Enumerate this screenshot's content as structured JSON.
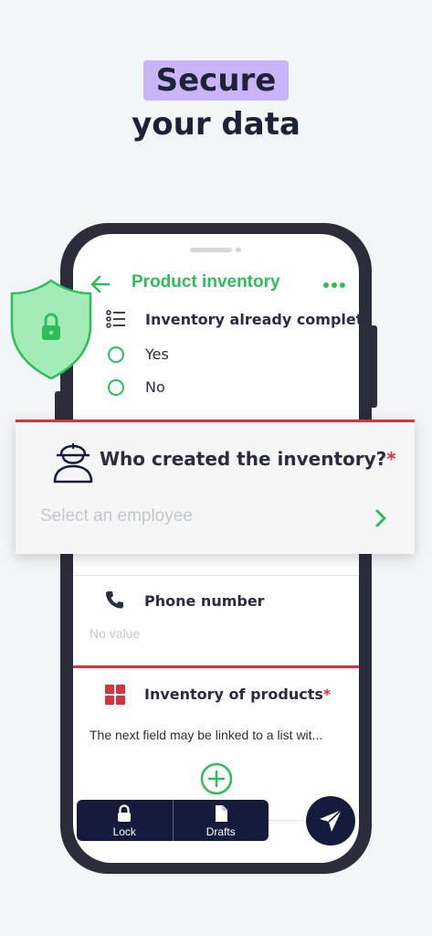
{
  "headline": {
    "line1": "Secure",
    "line2": "your data"
  },
  "app": {
    "title": "Product inventory",
    "back_icon": "arrow-left-icon",
    "more_icon": "more-dots-icon"
  },
  "question_complete": {
    "icon": "checklist-icon",
    "text": "Inventory already complete",
    "options": [
      {
        "label": "Yes"
      },
      {
        "label": "No"
      }
    ]
  },
  "employee_card": {
    "icon": "worker-helmet-icon",
    "question": "Who created the inventory?",
    "required_mark": "*",
    "placeholder": "Select an employee",
    "chevron_icon": "chevron-right-icon"
  },
  "phone_field": {
    "icon": "phone-icon",
    "label": "Phone number",
    "value": "No value"
  },
  "products_field": {
    "icon": "grid-icon",
    "label": "Inventory of products",
    "required_mark": "*",
    "description": "The next field may be linked to a list wit..."
  },
  "bottom_bar": {
    "items": [
      {
        "label": "Lock",
        "icon": "lock-icon"
      },
      {
        "label": "Drafts",
        "icon": "document-icon"
      }
    ],
    "send_icon": "send-icon"
  },
  "shield_icon": "shield-lock-icon",
  "colors": {
    "accent_green": "#2ebd59",
    "required_red": "#d8323f",
    "navy": "#141b3c",
    "highlight_purple": "#c9b4f7"
  }
}
